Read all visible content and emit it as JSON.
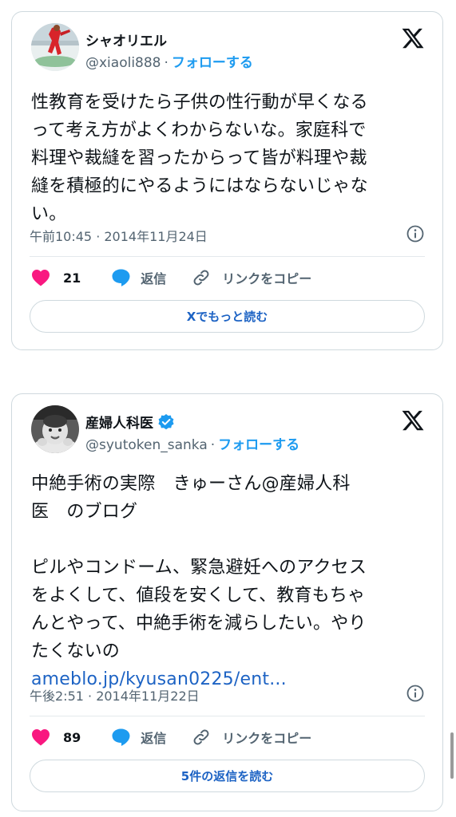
{
  "tweets": [
    {
      "author_name": "シャオリエル",
      "handle": "@xiaoli888",
      "follow_label": "フォローする",
      "text_lines": [
        "性教育を受けたら子供の性行動が早くなる",
        "って考え方がよくわからないな。家庭科で",
        "料理や裁縫を習ったからって皆が料理や裁",
        "縫を積極的にやるようにはならないじゃな",
        "い。"
      ],
      "timestamp": "午前10:45 · 2014年11月24日",
      "likes": "21",
      "reply_label": "返信",
      "copy_link_label": "リンクをコピー",
      "cta_label": "Xでもっと読む"
    },
    {
      "author_name": "産婦人科医",
      "verified": true,
      "handle": "@syutoken_sanka",
      "follow_label": "フォローする",
      "text_lines_1": [
        "中絶手術の実際　きゅーさん@産婦人科",
        "医　のブログ"
      ],
      "text_lines_2": [
        "ピルやコンドーム、緊急避妊へのアクセス",
        "をよくして、値段を安くして、教育もちゃ",
        "んとやって、中絶手術を減らしたい。やり",
        "たくないの"
      ],
      "link_text": "ameblo.jp/kyusan0225/ent...",
      "timestamp": "午後2:51 · 2014年11月22日",
      "likes": "89",
      "reply_label": "返信",
      "copy_link_label": "リンクをコピー",
      "cta_label": "5件の返信を読む"
    }
  ],
  "icons": {
    "brand": "x-logo-icon",
    "info": "info-icon",
    "like": "heart-icon",
    "reply": "speech-bubble-icon",
    "copy": "link-icon",
    "verified": "verified-badge-icon"
  },
  "colors": {
    "accent": "#1d9bf0",
    "link": "#1d63c4",
    "heart": "#f91880",
    "muted": "#536471",
    "border": "#cfd9de"
  }
}
